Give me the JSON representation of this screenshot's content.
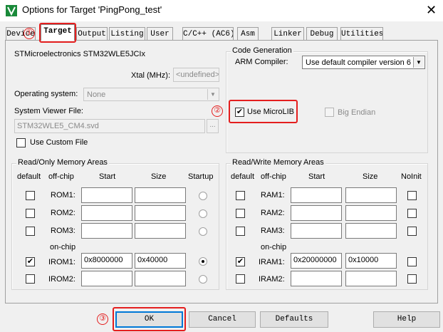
{
  "window": {
    "title": "Options for Target 'PingPong_test'",
    "close_glyph": "✕"
  },
  "tabs": [
    {
      "label": "Device",
      "active": false
    },
    {
      "label": "Target",
      "active": true
    },
    {
      "label": "Output",
      "active": false
    },
    {
      "label": "Listing",
      "active": false
    },
    {
      "label": "User",
      "active": false
    },
    {
      "label": "C/C++ (AC6)",
      "active": false
    },
    {
      "label": "Asm",
      "active": false
    },
    {
      "label": "Linker",
      "active": false
    },
    {
      "label": "Debug",
      "active": false
    },
    {
      "label": "Utilities",
      "active": false
    }
  ],
  "target": {
    "device_name": "STMicroelectronics STM32WLE5JCIx",
    "xtal_label": "Xtal (MHz):",
    "xtal_value": "<undefined>",
    "os_label": "Operating system:",
    "os_value": "None",
    "svd_label": "System Viewer File:",
    "svd_value": "STM32WLE5_CM4.svd",
    "browse_label": "...",
    "custom_file_label": "Use Custom File"
  },
  "codegen": {
    "group_title": "Code Generation",
    "compiler_label": "ARM Compiler:",
    "compiler_value": "Use default compiler version 6",
    "microlib_label": "Use MicroLIB",
    "microlib_checked": "✔",
    "big_endian_label": "Big Endian"
  },
  "ro_memory": {
    "group_title": "Read/Only Memory Areas",
    "headers": {
      "default": "default",
      "offchip": "off-chip",
      "start": "Start",
      "size": "Size",
      "last": "Startup"
    },
    "onchip_label": "on-chip",
    "rows": [
      {
        "name": "ROM1:",
        "start": "",
        "size": "",
        "default": "",
        "sel": false
      },
      {
        "name": "ROM2:",
        "start": "",
        "size": "",
        "default": "",
        "sel": false
      },
      {
        "name": "ROM3:",
        "start": "",
        "size": "",
        "default": "",
        "sel": false
      },
      {
        "name": "IROM1:",
        "start": "0x8000000",
        "size": "0x40000",
        "default": "✔",
        "sel": true
      },
      {
        "name": "IROM2:",
        "start": "",
        "size": "",
        "default": "",
        "sel": false
      }
    ]
  },
  "rw_memory": {
    "group_title": "Read/Write Memory Areas",
    "headers": {
      "default": "default",
      "offchip": "off-chip",
      "start": "Start",
      "size": "Size",
      "last": "NoInit"
    },
    "onchip_label": "on-chip",
    "rows": [
      {
        "name": "RAM1:",
        "start": "",
        "size": "",
        "default": ""
      },
      {
        "name": "RAM2:",
        "start": "",
        "size": "",
        "default": ""
      },
      {
        "name": "RAM3:",
        "start": "",
        "size": "",
        "default": ""
      },
      {
        "name": "IRAM1:",
        "start": "0x20000000",
        "size": "0x10000",
        "default": "✔"
      },
      {
        "name": "IRAM2:",
        "start": "",
        "size": "",
        "default": ""
      }
    ]
  },
  "buttons": {
    "ok": "OK",
    "cancel": "Cancel",
    "defaults": "Defaults",
    "help": "Help"
  },
  "annotations": {
    "n1": "①",
    "n2": "②",
    "n3": "③",
    "color": "#e41e1e"
  }
}
